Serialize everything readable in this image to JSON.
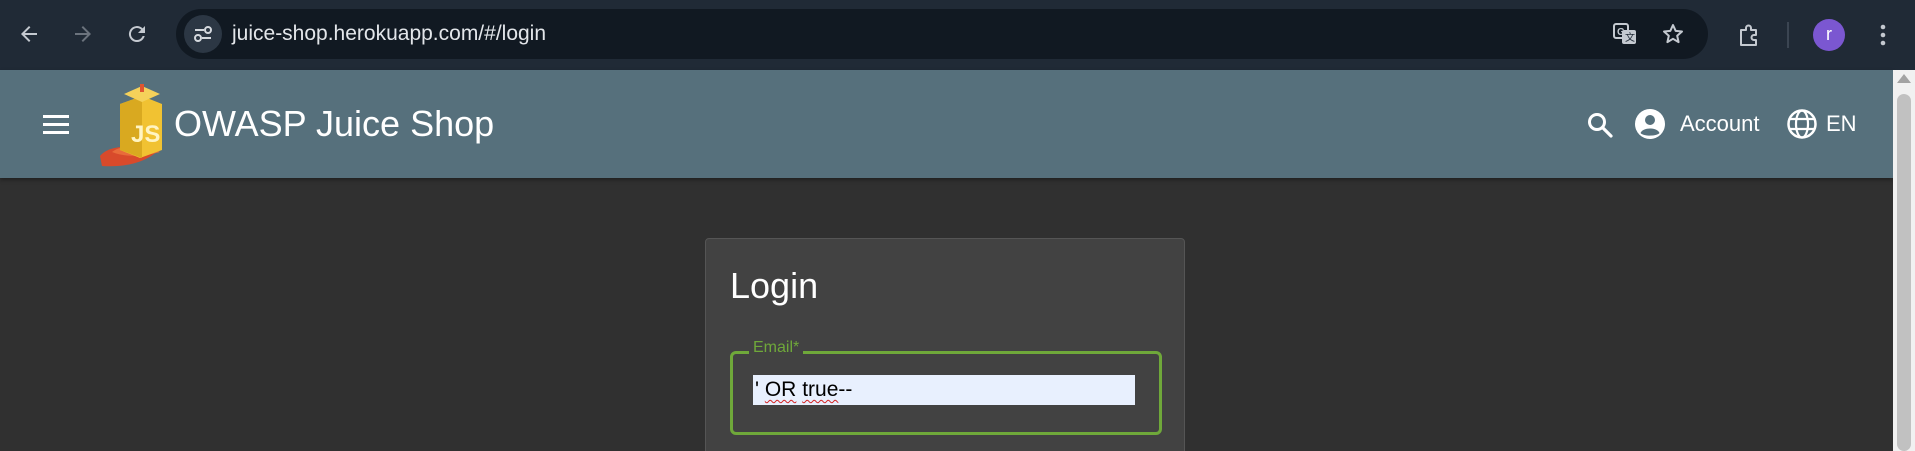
{
  "browser": {
    "url": "juice-shop.herokuapp.com/#/login",
    "profile_initial": "r",
    "icons": [
      "back-icon",
      "forward-icon",
      "reload-icon",
      "site-info-icon",
      "translate-icon",
      "star-icon",
      "extensions-icon",
      "more-icon"
    ]
  },
  "app": {
    "title": "OWASP Juice Shop",
    "account_label": "Account",
    "language_label": "EN",
    "colors": {
      "toolbar": "#56707c",
      "background": "#303030",
      "accent": "#6fa83a"
    }
  },
  "login": {
    "title": "Login",
    "email_label": "Email*",
    "email_value_prefix": "' ",
    "email_value_word1": "OR",
    "email_value_space": " ",
    "email_value_word2": "true",
    "email_value_suffix": "--"
  }
}
